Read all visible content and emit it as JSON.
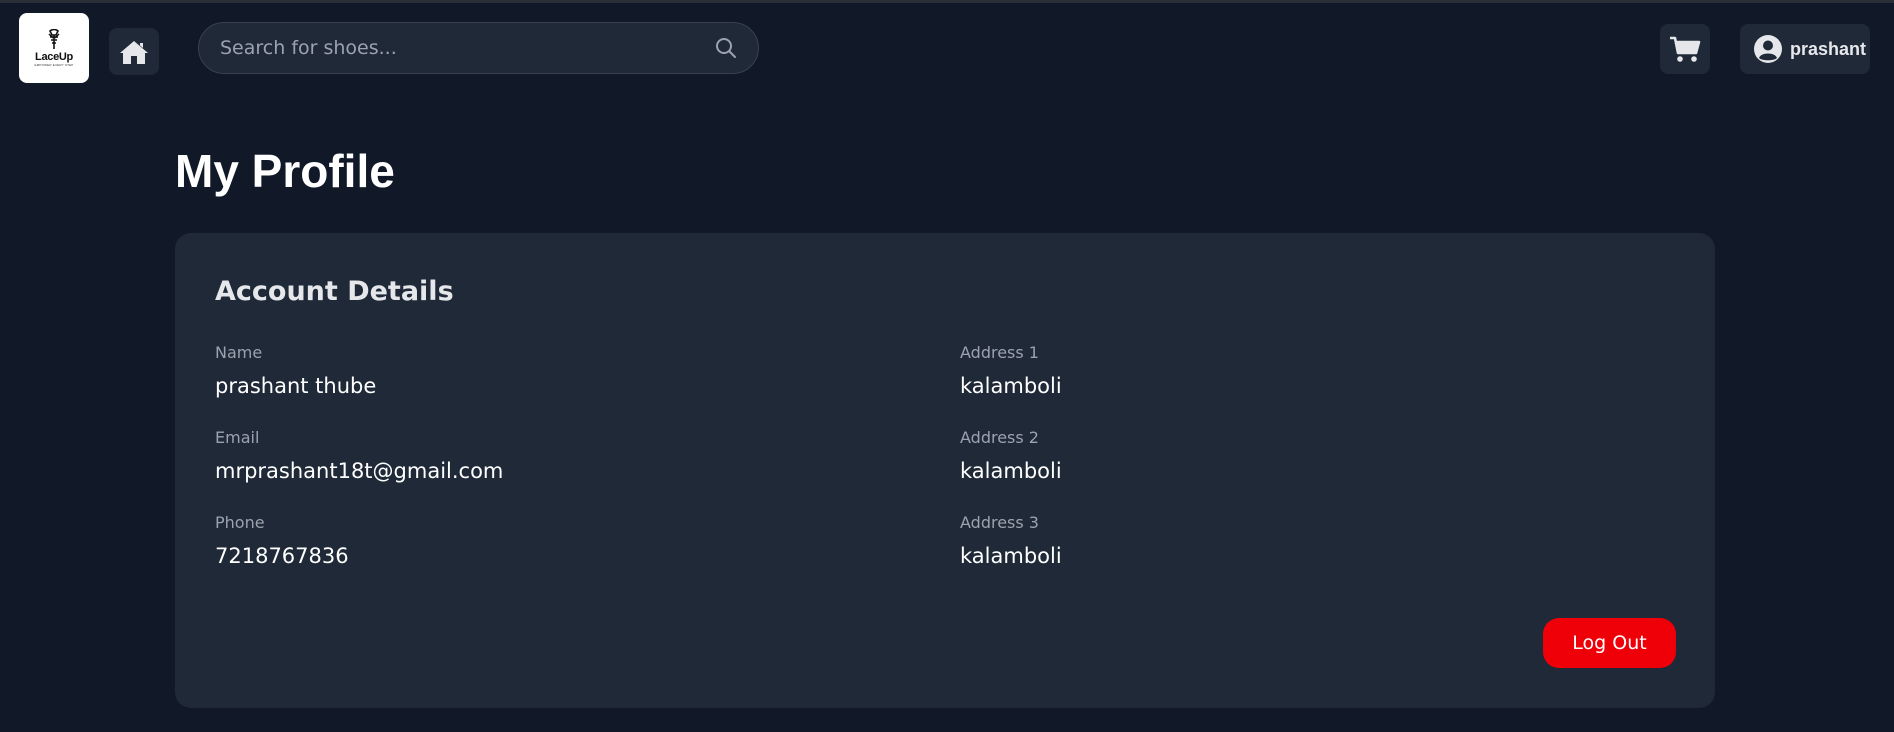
{
  "brand": {
    "name": "LaceUp",
    "tagline": "EMPOWER EVERY STEP",
    "logo_icon": "shoe-logo-icon"
  },
  "header": {
    "home_icon": "home-icon",
    "search": {
      "placeholder": "Search for shoes...",
      "value": "",
      "icon": "search-icon"
    },
    "cart_icon": "cart-icon",
    "user": {
      "icon": "user-circle-icon",
      "name": "prashant"
    }
  },
  "page": {
    "title": "My Profile"
  },
  "account": {
    "title": "Account Details",
    "left_fields": [
      {
        "label": "Name",
        "value": "prashant thube"
      },
      {
        "label": "Email",
        "value": "mrprashant18t@gmail.com"
      },
      {
        "label": "Phone",
        "value": "7218767836"
      }
    ],
    "right_fields": [
      {
        "label": "Address 1",
        "value": "kalamboli"
      },
      {
        "label": "Address 2",
        "value": "kalamboli"
      },
      {
        "label": "Address 3",
        "value": "kalamboli"
      }
    ],
    "logout_label": "Log Out"
  },
  "colors": {
    "background": "#111827",
    "surface": "#1f2937",
    "muted_text": "#9ca3af",
    "danger": "#ef0009"
  }
}
